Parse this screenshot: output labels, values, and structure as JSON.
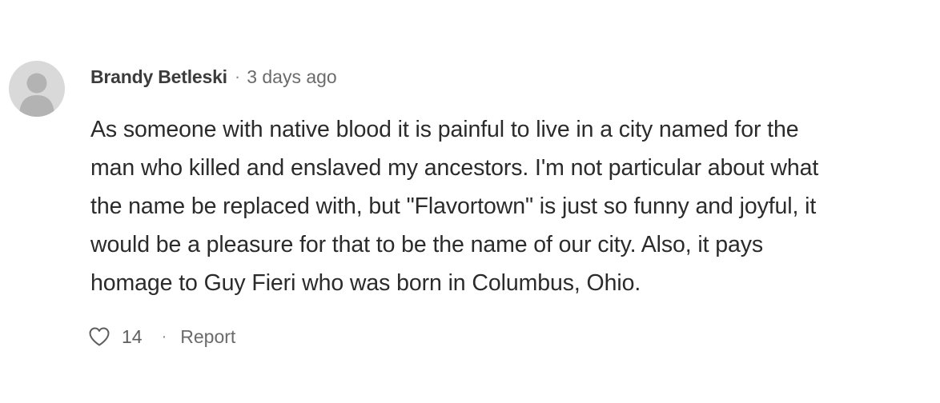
{
  "comment": {
    "author": "Brandy Betleski",
    "separator": "·",
    "timestamp": "3 days ago",
    "body_lines": [
      "As someone with native blood it is painful to live in a city named for the",
      "man who killed and enslaved my ancestors. I'm not particular about what",
      "the name be replaced with, but \"Flavortown\" is just so funny and joyful, it",
      "would be a pleasure for that to be the name of our city. Also, it pays",
      "homage to Guy Fieri who was born in Columbus, Ohio."
    ],
    "like_count": "14",
    "action_separator": "·",
    "report_label": "Report"
  },
  "icons": {
    "avatar": "user-placeholder-icon",
    "like": "heart-icon"
  },
  "colors": {
    "avatar_bg": "#d9d9d9",
    "avatar_fg": "#b3b3b3",
    "text": "#292929",
    "muted": "#6b6b6b"
  }
}
